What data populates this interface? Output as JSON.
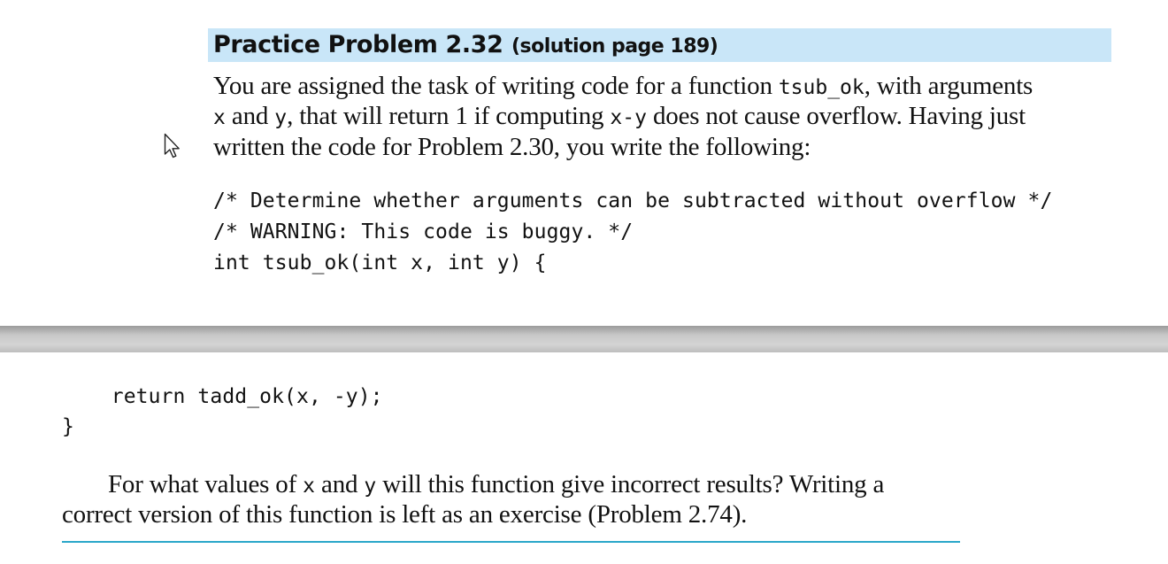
{
  "problem": {
    "title": "Practice Problem 2.32",
    "reference": "(solution page 189)"
  },
  "intro": {
    "line1": [
      "You are assigned the task of writing code for a function ",
      "tsub_ok",
      ", with arguments"
    ],
    "line2": [
      "x",
      " and ",
      "y",
      ", that will return 1 if computing ",
      "x-y",
      " does not cause overflow. Having just"
    ],
    "line3": "written the code for Problem 2.30, you write the following:"
  },
  "code_top": [
    "/* Determine whether arguments can be subtracted without overflow */",
    "/* WARNING: This code is buggy. */",
    "int tsub_ok(int x, int y) {"
  ],
  "code_bottom": [
    "    return tadd_ok(x, -y);",
    "}"
  ],
  "question": {
    "line1": [
      "For what values of ",
      "x",
      " and ",
      "y",
      " will this function give incorrect results? Writing a"
    ],
    "line2": "correct version of this function is left as an exercise (Problem 2.74)."
  },
  "icons": {
    "cursor": "mouse-pointer-icon"
  },
  "colors": {
    "header_background": "#c9e6f8",
    "rule": "#2aa7c9"
  }
}
